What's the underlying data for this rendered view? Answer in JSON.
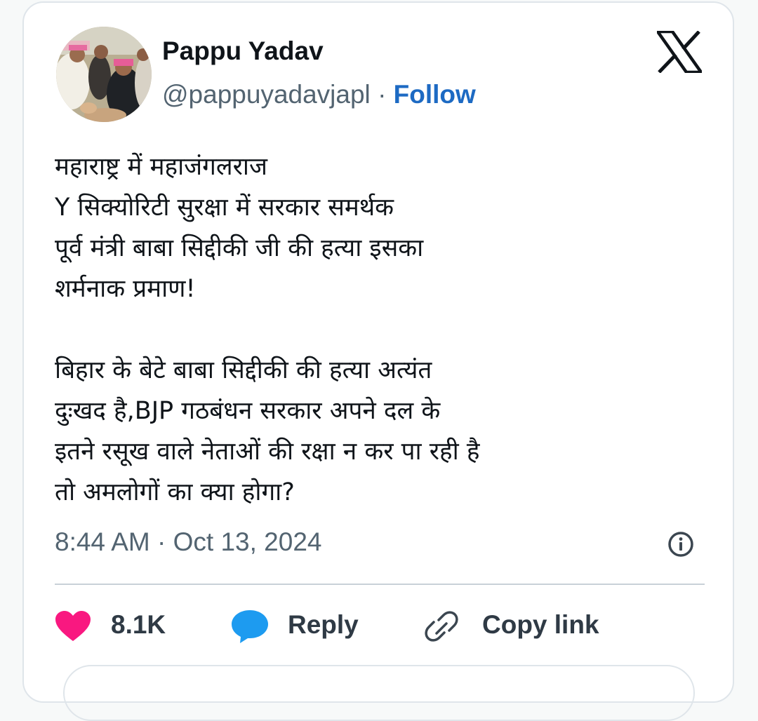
{
  "author": {
    "name": "Pappu Yadav",
    "handle": "@pappuyadavjapl",
    "separator": "·",
    "follow_label": "Follow"
  },
  "tweet": {
    "paragraphs": [
      [
        "महाराष्ट्र में महाजंगलराज",
        "Y सिक्योरिटी सुरक्षा में सरकार समर्थक",
        "पूर्व मंत्री बाबा सिद्दीकी जी की हत्या इसका",
        "शर्मनाक प्रमाण!"
      ],
      [
        "बिहार के बेटे बाबा सिद्दीकी की हत्या अत्यंत",
        "दुःखद है,BJP गठबंधन सरकार अपने दल के",
        "इतने रसूख वाले नेताओं की रक्षा न कर पा रही है",
        "तो अमलोगों का क्या होगा?"
      ]
    ],
    "timestamp": "8:44 AM · Oct 13, 2024"
  },
  "actions": {
    "likes": "8.1K",
    "reply_label": "Reply",
    "copy_link_label": "Copy link"
  },
  "icons": {
    "platform": "x-logo-icon",
    "info": "info-icon",
    "like": "heart-icon",
    "reply": "speech-bubble-icon",
    "copy": "link-icon"
  },
  "colors": {
    "follow": "#1d6ac3",
    "heart": "#f91880",
    "reply": "#1d9bf0",
    "text": "#0f1419",
    "muted": "#536471"
  }
}
